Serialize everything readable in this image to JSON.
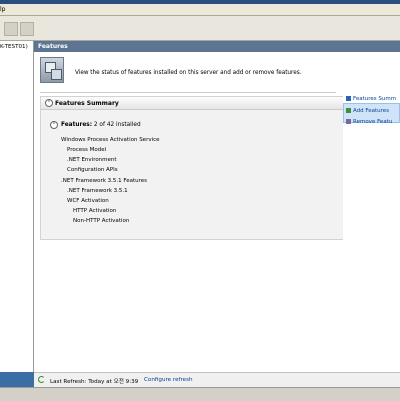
{
  "menu": {
    "partial_label": "lp"
  },
  "tree": {
    "selected_node": "K-TEST01)"
  },
  "content": {
    "header_title": "Features",
    "description": "View the status of features installed on this server and add or remove features.",
    "summary": {
      "title": "Features Summary",
      "features_label": "Features:",
      "features_count": "2 of 42 installed",
      "items": [
        "Windows Process Activation Service",
        "Process Model",
        ".NET Environment",
        "Configuration APIs",
        ".NET Framework 3.5.1 Features",
        ".NET Framework 3.5.1",
        "WCF Activation",
        "HTTP Activation",
        "Non-HTTP Activation"
      ]
    }
  },
  "actions": {
    "summary_link": "Features Summ",
    "add": "Add Features",
    "remove": "Remove Featu"
  },
  "status": {
    "last_refresh": "Last Refresh: Today at 오전 9:39",
    "configure": "Configure refresh"
  },
  "colors": {
    "header_bg": "#5b7592",
    "link": "#0a3f96",
    "highlight": "#cfe4f8"
  }
}
